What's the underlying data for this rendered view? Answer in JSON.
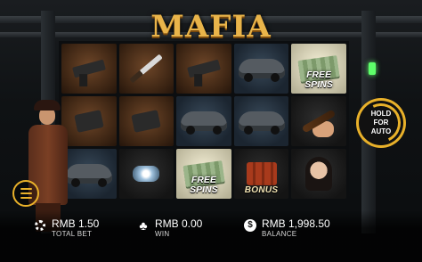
{
  "game": {
    "title": "MAFIA"
  },
  "reels": [
    {
      "id": "r1c1",
      "symbol": "pistol-icon"
    },
    {
      "id": "r1c2",
      "symbol": "knife-icon"
    },
    {
      "id": "r1c3",
      "symbol": "pistol-icon"
    },
    {
      "id": "r1c4",
      "symbol": "car-icon"
    },
    {
      "id": "r1c5",
      "symbol": "free-spins-cash-icon",
      "label": "FREE SPINS"
    },
    {
      "id": "r2c1",
      "symbol": "ammo-clip-icon"
    },
    {
      "id": "r2c2",
      "symbol": "ammo-clip-icon"
    },
    {
      "id": "r2c3",
      "symbol": "car-icon"
    },
    {
      "id": "r2c4",
      "symbol": "car-icon"
    },
    {
      "id": "r2c5",
      "symbol": "cigar-icon"
    },
    {
      "id": "r3c1",
      "symbol": "car-icon"
    },
    {
      "id": "r3c2",
      "symbol": "jewels-icon"
    },
    {
      "id": "r3c3",
      "symbol": "free-spins-cash-icon",
      "label": "FREE SPINS"
    },
    {
      "id": "r3c4",
      "symbol": "dynamite-bonus-icon",
      "label": "BONUS"
    },
    {
      "id": "r3c5",
      "symbol": "woman-icon"
    }
  ],
  "controls": {
    "menu_icon": "hamburger-menu-icon",
    "auto_line1": "HOLD",
    "auto_line2": "FOR",
    "auto_line3": "AUTO"
  },
  "stats": {
    "total_bet": {
      "amount": "RMB 1.50",
      "label": "TOTAL BET",
      "icon": "gear-icon"
    },
    "win": {
      "amount": "RMB 0.00",
      "label": "WIN",
      "icon": "club-icon"
    },
    "balance": {
      "amount": "RMB 1,998.50",
      "label": "BALANCE",
      "icon": "dollar-coin-icon"
    }
  },
  "colors": {
    "accent_gold": "#e9b12a",
    "title_gold": "#e9b44a",
    "status_green": "#5eff6a"
  }
}
